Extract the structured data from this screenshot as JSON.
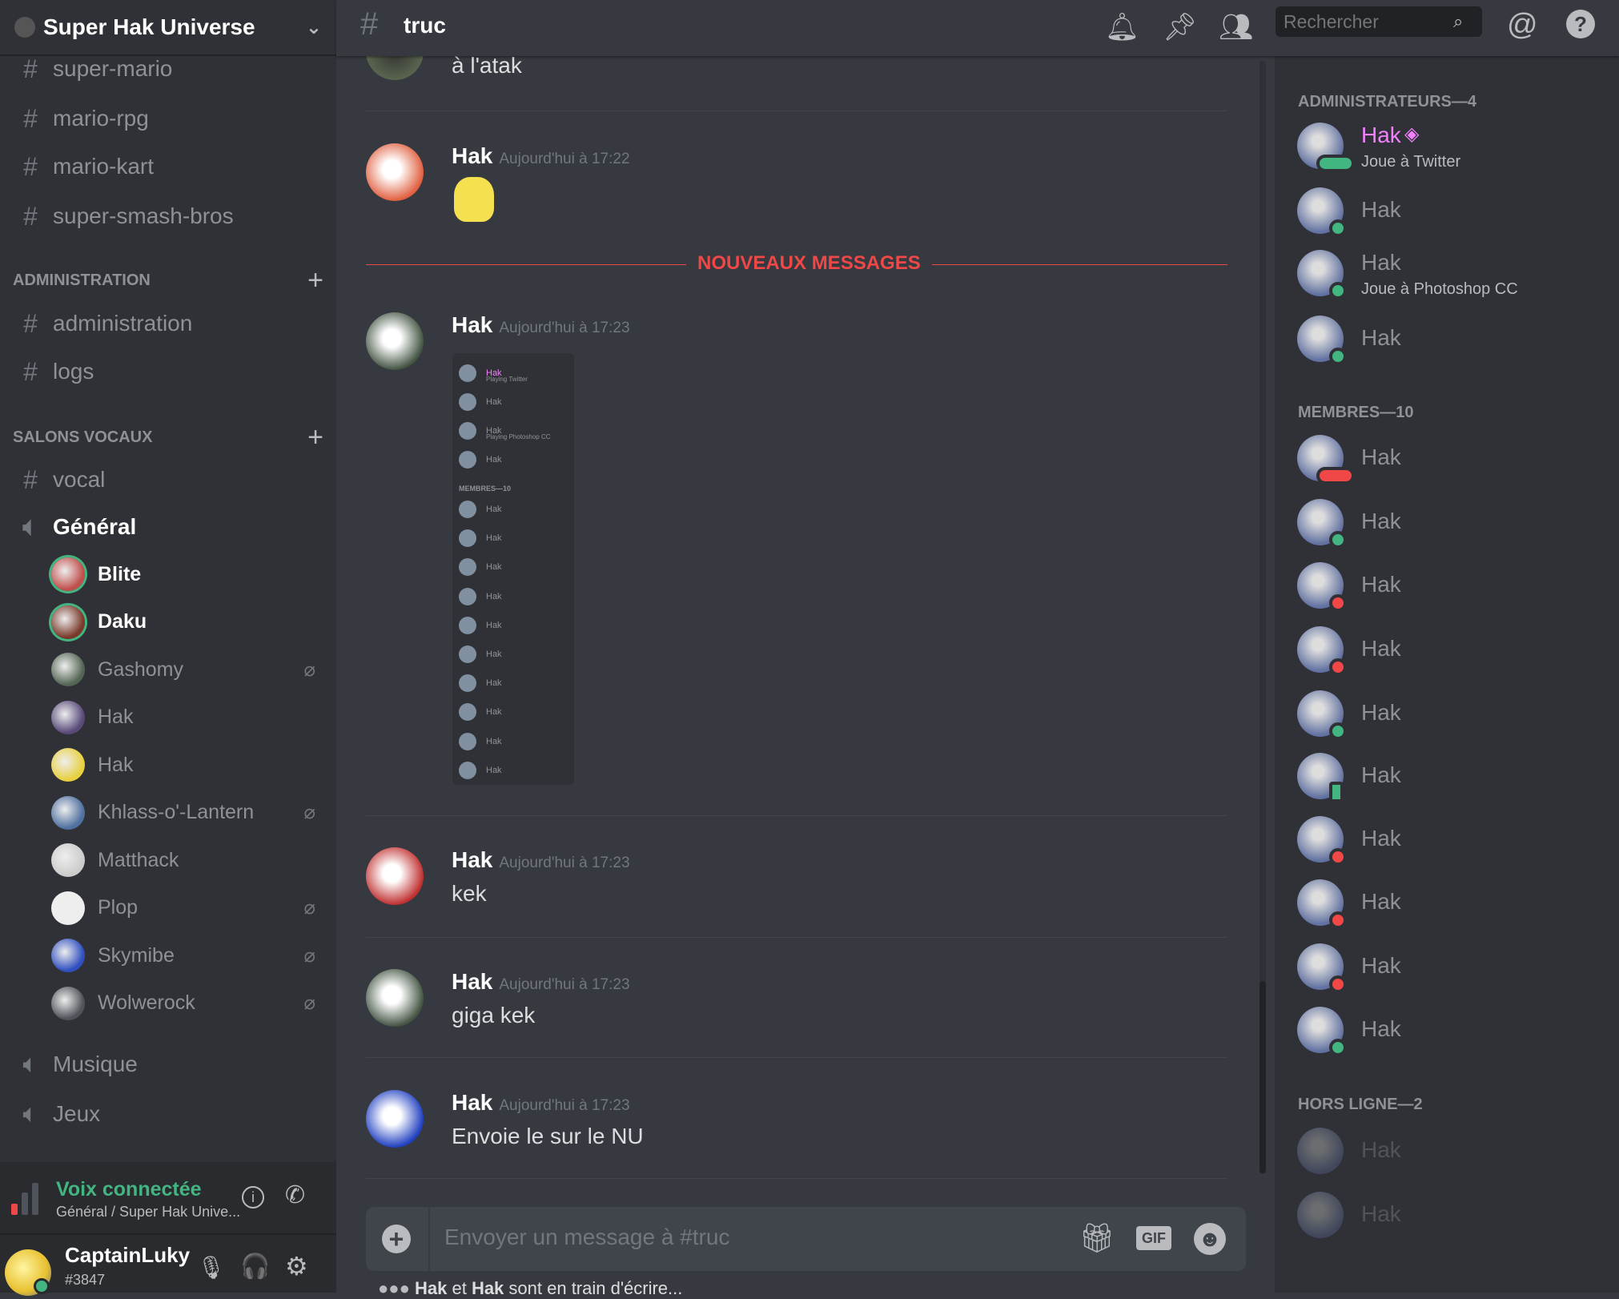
{
  "server": {
    "name": "Super Hak Universe"
  },
  "channels": [
    {
      "type": "text",
      "name": "super-mario"
    },
    {
      "type": "text",
      "name": "mario-rpg"
    },
    {
      "type": "text",
      "name": "mario-kart"
    },
    {
      "type": "text",
      "name": "super-smash-bros"
    }
  ],
  "categories": {
    "admin": "ADMINISTRATION",
    "voice": "SALONS VOCAUX"
  },
  "admin_channels": [
    {
      "name": "administration"
    },
    {
      "name": "logs"
    }
  ],
  "voice_channels": {
    "vocal": "vocal",
    "general": "Général",
    "musique": "Musique",
    "jeux": "Jeux"
  },
  "voice_users": [
    {
      "name": "Blite",
      "speaking": true,
      "muted": false,
      "color": "#c0504d"
    },
    {
      "name": "Daku",
      "speaking": true,
      "muted": false,
      "color": "#7a3a2a"
    },
    {
      "name": "Gashomy",
      "speaking": false,
      "muted": true,
      "color": "#556655"
    },
    {
      "name": "Hak",
      "speaking": false,
      "muted": false,
      "color": "#5a4a7a"
    },
    {
      "name": "Hak",
      "speaking": false,
      "muted": false,
      "color": "#e8d040"
    },
    {
      "name": "Khlass-o'-Lantern",
      "speaking": false,
      "muted": true,
      "color": "#5070a0"
    },
    {
      "name": "Matthack",
      "speaking": false,
      "muted": false,
      "color": "#cccccc"
    },
    {
      "name": "Plop",
      "speaking": false,
      "muted": true,
      "color": "#eeeeee"
    },
    {
      "name": "Skymibe",
      "speaking": false,
      "muted": true,
      "color": "#3050c0"
    },
    {
      "name": "Wolwerock",
      "speaking": false,
      "muted": true,
      "color": "#50545a"
    }
  ],
  "voice_panel": {
    "status": "Voix connectée",
    "location": "Général / Super Hak Unive..."
  },
  "user": {
    "name": "CaptainLuky",
    "tag": "#3847"
  },
  "topbar": {
    "channel": "truc",
    "search_placeholder": "Rechercher"
  },
  "messages": [
    {
      "author": "",
      "time": "",
      "text": "à l'atak"
    },
    {
      "author": "Hak",
      "time": "Aujourd'hui à 17:22",
      "text": "",
      "emoji": "pikachu"
    },
    {
      "author": "Hak",
      "time": "Aujourd'hui à 17:23",
      "text": "",
      "image": "member-list-screenshot"
    },
    {
      "author": "Hak",
      "time": "Aujourd'hui à 17:23",
      "text": "kek"
    },
    {
      "author": "Hak",
      "time": "Aujourd'hui à 17:23",
      "text": "giga kek"
    },
    {
      "author": "Hak",
      "time": "Aujourd'hui à 17:23",
      "text": "Envoie le sur le NU"
    }
  ],
  "new_messages_label": "NOUVEAUX MESSAGES",
  "composer": {
    "placeholder": "Envoyer un message à #truc",
    "gif": "GIF"
  },
  "typing": {
    "a": "Hak",
    "et": " et ",
    "b": "Hak",
    "rest": " sont en train d'écrire..."
  },
  "member_groups": {
    "admins": "ADMINISTRATEURS—4",
    "members": "MEMBRES—10",
    "offline": "HORS LIGNE—2"
  },
  "admins": [
    {
      "name": "Hak",
      "activity": "Joue à Twitter",
      "status": "typing",
      "color": "#f47fff",
      "owner": true
    },
    {
      "name": "Hak",
      "status": "online"
    },
    {
      "name": "Hak",
      "activity": "Joue à Photoshop CC",
      "status": "online"
    },
    {
      "name": "Hak",
      "status": "online"
    }
  ],
  "members": [
    {
      "name": "Hak",
      "status": "dnd-typing"
    },
    {
      "name": "Hak",
      "status": "online"
    },
    {
      "name": "Hak",
      "status": "dnd"
    },
    {
      "name": "Hak",
      "status": "dnd"
    },
    {
      "name": "Hak",
      "status": "online"
    },
    {
      "name": "Hak",
      "status": "mobile"
    },
    {
      "name": "Hak",
      "status": "dnd"
    },
    {
      "name": "Hak",
      "status": "dnd"
    },
    {
      "name": "Hak",
      "status": "dnd"
    },
    {
      "name": "Hak",
      "status": "online"
    }
  ],
  "offline": [
    {
      "name": "Hak"
    },
    {
      "name": "Hak"
    }
  ],
  "colors": {
    "online": "#43b581",
    "dnd": "#f04747",
    "accent": "#f04747",
    "voice": "#43b581"
  },
  "embed_image": {
    "header": "MEMBRES—10",
    "rows": [
      "Hak",
      "Hak",
      "Hak",
      "Hak",
      "Hak",
      "Hak",
      "Hak",
      "Hak",
      "Hak",
      "Hak"
    ],
    "admin_rows": [
      "Hak",
      "Hak",
      "Hak",
      "Hak"
    ],
    "activities": [
      "Playing Twitter",
      "Playing Photoshop CC"
    ]
  }
}
